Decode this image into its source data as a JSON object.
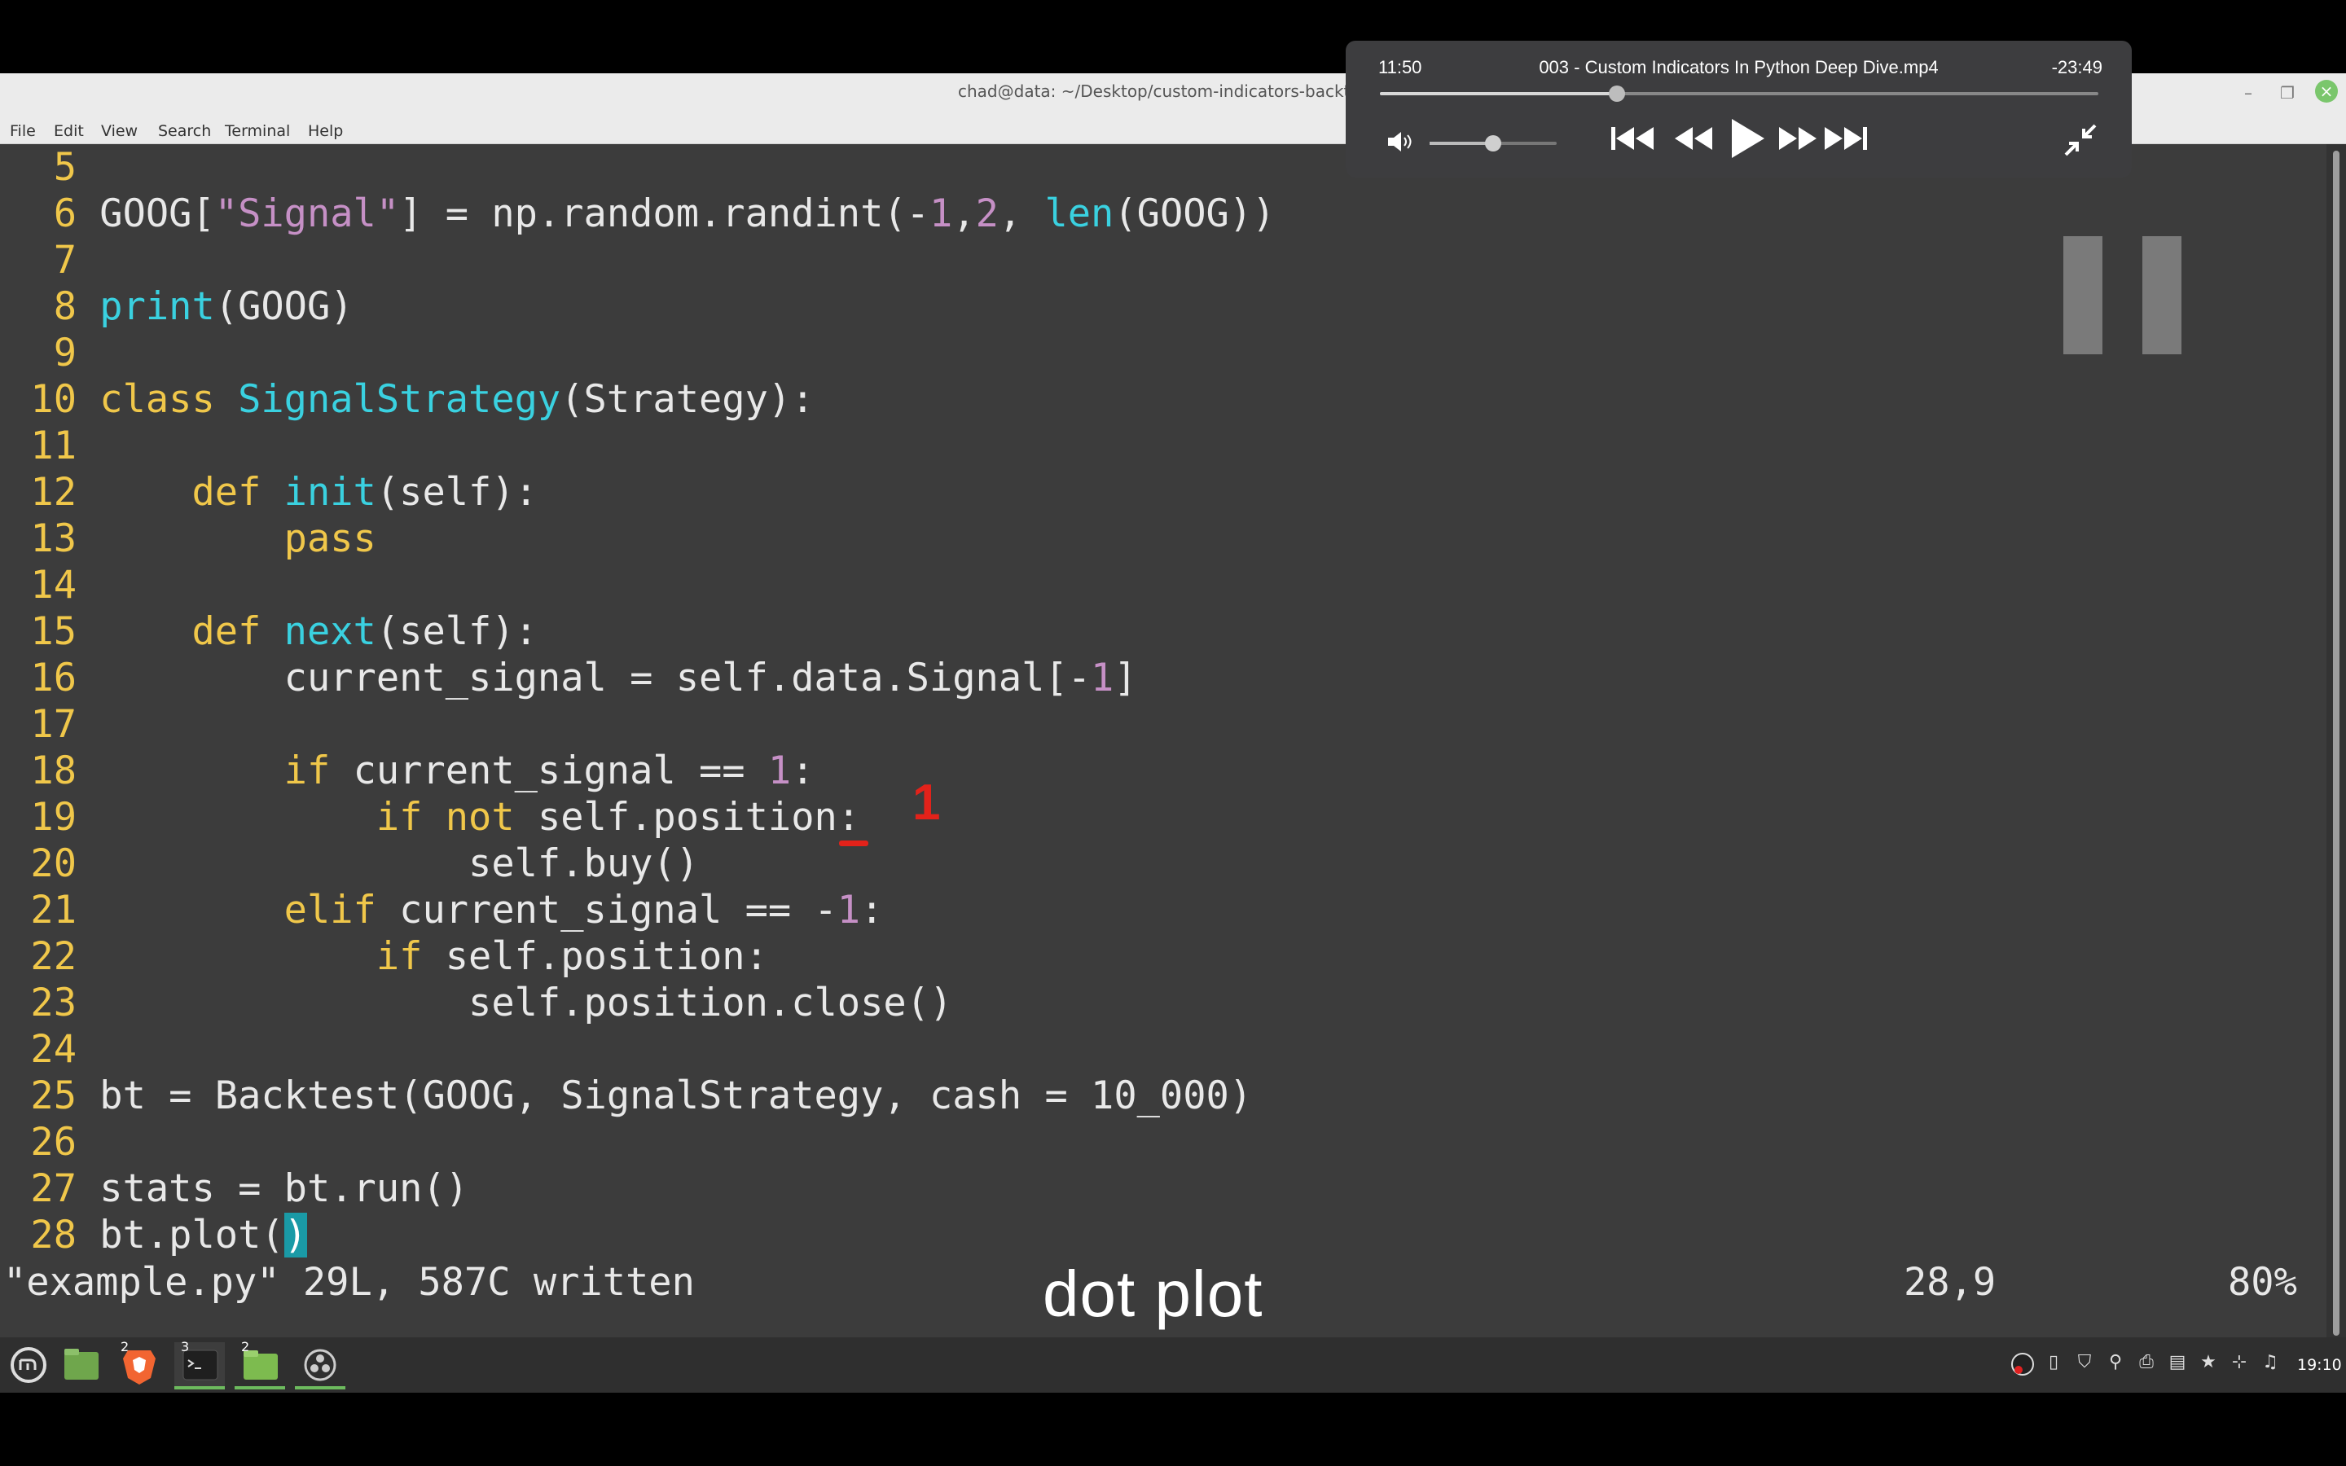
{
  "window": {
    "title": "chad@data: ~/Desktop/custom-indicators-backtest",
    "menu": [
      "File",
      "Edit",
      "View",
      "Search",
      "Terminal",
      "Help"
    ]
  },
  "editor": {
    "lines": [
      {
        "n": "5",
        "tokens": []
      },
      {
        "n": "6",
        "tokens": [
          [
            "GOOG[",
            "w"
          ],
          [
            "\"Signal\"",
            "p"
          ],
          [
            "] = np.random.randint(-",
            "w"
          ],
          [
            "1",
            "p"
          ],
          [
            ",",
            "w"
          ],
          [
            "2",
            "p"
          ],
          [
            ", ",
            "w"
          ],
          [
            "len",
            "c"
          ],
          [
            "(GOOG))",
            "w"
          ]
        ]
      },
      {
        "n": "7",
        "tokens": []
      },
      {
        "n": "8",
        "tokens": [
          [
            "print",
            "c"
          ],
          [
            "(GOOG)",
            "w"
          ]
        ]
      },
      {
        "n": "9",
        "tokens": []
      },
      {
        "n": "10",
        "tokens": [
          [
            "class ",
            "y"
          ],
          [
            "SignalStrategy",
            "c"
          ],
          [
            "(Strategy):",
            "w"
          ]
        ]
      },
      {
        "n": "11",
        "tokens": []
      },
      {
        "n": "12",
        "tokens": [
          [
            "    def ",
            "y"
          ],
          [
            "init",
            "c"
          ],
          [
            "(self):",
            "w"
          ]
        ]
      },
      {
        "n": "13",
        "tokens": [
          [
            "        pass",
            "y"
          ]
        ]
      },
      {
        "n": "14",
        "tokens": []
      },
      {
        "n": "15",
        "tokens": [
          [
            "    def ",
            "y"
          ],
          [
            "next",
            "c"
          ],
          [
            "(self):",
            "w"
          ]
        ]
      },
      {
        "n": "16",
        "tokens": [
          [
            "        current_signal = self.data.Signal[-",
            "w"
          ],
          [
            "1",
            "p"
          ],
          [
            "]",
            "w"
          ]
        ]
      },
      {
        "n": "17",
        "tokens": []
      },
      {
        "n": "18",
        "tokens": [
          [
            "        if ",
            "y"
          ],
          [
            "current_signal == ",
            "w"
          ],
          [
            "1",
            "p"
          ],
          [
            ":",
            "w"
          ]
        ]
      },
      {
        "n": "19",
        "tokens": [
          [
            "            if not ",
            "y"
          ],
          [
            "self.position:",
            "w"
          ]
        ]
      },
      {
        "n": "20",
        "tokens": [
          [
            "                self.buy()",
            "w"
          ]
        ]
      },
      {
        "n": "21",
        "tokens": [
          [
            "        elif ",
            "y"
          ],
          [
            "current_signal == -",
            "w"
          ],
          [
            "1",
            "p"
          ],
          [
            ":",
            "w"
          ]
        ]
      },
      {
        "n": "22",
        "tokens": [
          [
            "            if ",
            "y"
          ],
          [
            "self.position:",
            "w"
          ]
        ]
      },
      {
        "n": "23",
        "tokens": [
          [
            "                self.position.close()",
            "w"
          ]
        ]
      },
      {
        "n": "24",
        "tokens": []
      },
      {
        "n": "25",
        "tokens": [
          [
            "bt = Backtest(GOOG, SignalStrategy, cash = 10_000)",
            "w"
          ]
        ]
      },
      {
        "n": "26",
        "tokens": []
      },
      {
        "n": "27",
        "tokens": [
          [
            "stats = bt.run()",
            "w"
          ]
        ]
      },
      {
        "n": "28",
        "tokens": [
          [
            "bt.plot",
            "w"
          ],
          [
            "(",
            "w"
          ],
          [
            ")",
            "cur"
          ]
        ]
      }
    ],
    "status_message": "\"example.py\" 29L, 587C written",
    "cursor_position": "28,9",
    "scroll_percent": "80%",
    "caption": "dot plot",
    "annotation_mark": "1"
  },
  "player": {
    "elapsed": "11:50",
    "title": "003 - Custom Indicators In Python Deep Dive.mp4",
    "remaining": "-23:49",
    "progress_fraction": 0.33,
    "volume_fraction": 0.5
  },
  "taskbar": {
    "clock": "19:10",
    "apps": [
      "menu",
      "files",
      "brave",
      "terminal",
      "folder",
      "obs"
    ],
    "badges": {
      "brave": "2",
      "terminal": "3",
      "folder": "2"
    }
  },
  "colors": {
    "white": "#e8e8e8",
    "purple": "#c690c6",
    "cyan": "#3ad1e0",
    "yellow": "#f0c74a",
    "accent_green": "#6dbb5e",
    "annotation_red": "#e3221a"
  }
}
